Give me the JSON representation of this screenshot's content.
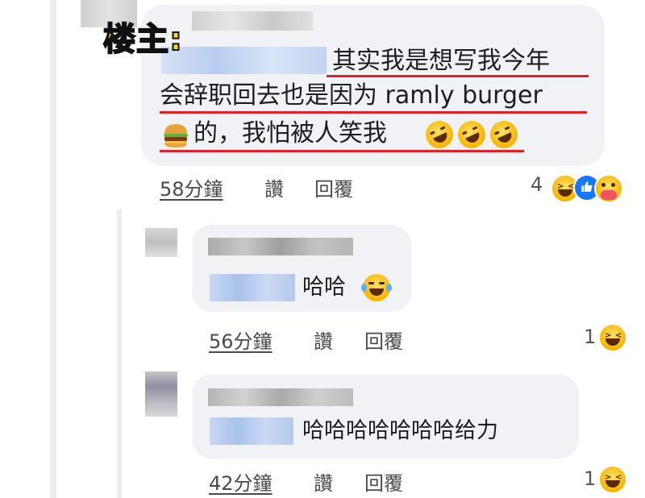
{
  "post": {
    "op_tag": "楼主:",
    "line1": "其实我是想写我今年",
    "line2": "会辞职回去也是因为 ramly burger",
    "line3": "的，我怕被人笑我",
    "time": "58分鐘",
    "like_label": "讚",
    "reply_label": "回覆",
    "reaction_count": "4"
  },
  "replies": [
    {
      "text": "哈哈",
      "time": "56分鐘",
      "like_label": "讚",
      "reply_label": "回覆",
      "reaction_count": "1"
    },
    {
      "text": "哈哈哈哈哈哈哈给力",
      "time": "42分鐘",
      "like_label": "讚",
      "reply_label": "回覆",
      "reaction_count": "1"
    }
  ],
  "colors": {
    "bubble": "#f0f2f5",
    "underline": "#e41e26",
    "op_tag_fill": "#ffd60a"
  },
  "icons": [
    "laughing-face-icon",
    "like-icon",
    "care-face-icon",
    "burger-icon",
    "rofl-face-icon",
    "tears-of-joy-icon"
  ]
}
